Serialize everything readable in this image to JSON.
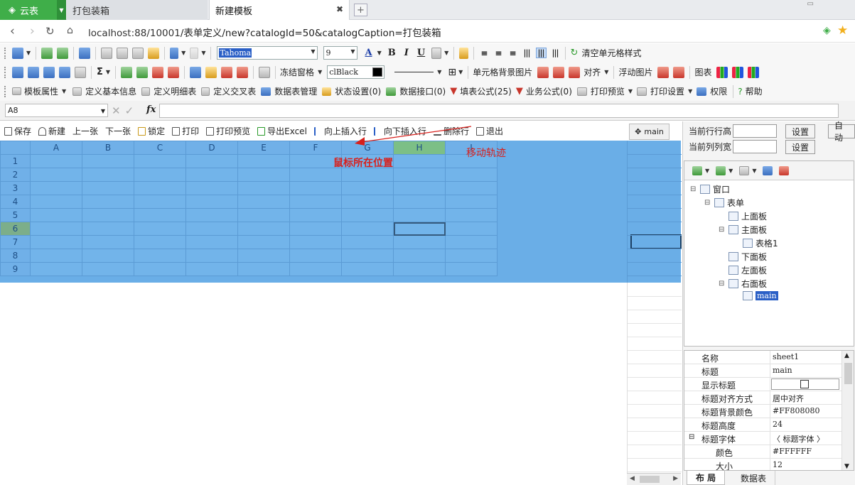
{
  "browser": {
    "brand": "云表",
    "tabs": [
      {
        "label": "打包装箱",
        "active": false
      },
      {
        "label": "新建模板",
        "active": true
      }
    ],
    "url": {
      "prefix": "localhost:88/10001",
      "path": "/表单定义/new?catalogId=50&catalogCaption=打包装箱"
    }
  },
  "toolbar1": {
    "font": "Tahoma",
    "size": "9",
    "clear_style": "清空单元格样式"
  },
  "toolbar2": {
    "freeze": "冻结窗格",
    "color": "clBlack",
    "cell_bg": "单元格背景图片",
    "align": "对齐",
    "float_img": "浮动图片",
    "chart": "图表"
  },
  "toolbar3": {
    "items": [
      "模板属性",
      "定义基本信息",
      "定义明细表",
      "定义交叉表",
      "数据表管理",
      "状态设置(0)",
      "数据接口(0)",
      "填表公式(25)",
      "业务公式(0)",
      "打印预览",
      "打印设置",
      "权限",
      "帮助"
    ]
  },
  "formula": {
    "cell_ref": "A8",
    "fx": "fx"
  },
  "formbar": {
    "items": [
      "保存",
      "新建",
      "上一张",
      "下一张",
      "锁定",
      "打印",
      "打印预览",
      "导出Excel",
      "向上插入行",
      "向下插入行",
      "删除行",
      "退出"
    ]
  },
  "main_chip": "main",
  "grid": {
    "columns": [
      "A",
      "B",
      "C",
      "D",
      "E",
      "F",
      "G",
      "H",
      "I"
    ],
    "rows": [
      "1",
      "2",
      "3",
      "4",
      "5",
      "6",
      "7",
      "8",
      "9"
    ],
    "selected_col": "H",
    "selected_row": "6"
  },
  "annotations": {
    "mouse_pos": "鼠标所在位置",
    "move_track": "移动轨迹"
  },
  "rpanel": {
    "row_height_label": "当前行行高",
    "col_width_label": "当前列列宽",
    "set": "设置",
    "auto": "自动"
  },
  "tree": [
    {
      "label": "窗口",
      "level": 0,
      "pm": "⊟"
    },
    {
      "label": "表单",
      "level": 1,
      "pm": "⊟"
    },
    {
      "label": "上面板",
      "level": 2,
      "pm": ""
    },
    {
      "label": "主面板",
      "level": 2,
      "pm": "⊟"
    },
    {
      "label": "表格1",
      "level": 3,
      "pm": ""
    },
    {
      "label": "下面板",
      "level": 2,
      "pm": ""
    },
    {
      "label": "左面板",
      "level": 2,
      "pm": ""
    },
    {
      "label": "右面板",
      "level": 2,
      "pm": "⊟"
    },
    {
      "label": "main",
      "level": 3,
      "pm": "",
      "selected": true
    }
  ],
  "props": [
    {
      "k": "名称",
      "v": "sheet1"
    },
    {
      "k": "标题",
      "v": "main"
    },
    {
      "k": "显示标题",
      "v": "",
      "checkbox": true
    },
    {
      "k": "标题对齐方式",
      "v": "居中对齐"
    },
    {
      "k": "标题背景颜色",
      "v": "#FF808080"
    },
    {
      "k": "标题高度",
      "v": "24"
    },
    {
      "k": "标题字体",
      "v": "〈 标题字体 〉",
      "group": true
    },
    {
      "k": "颜色",
      "v": "#FFFFFF",
      "indent": true
    },
    {
      "k": "大小",
      "v": "12",
      "indent": true
    }
  ],
  "ptabs": [
    "布 局",
    "数据表"
  ]
}
